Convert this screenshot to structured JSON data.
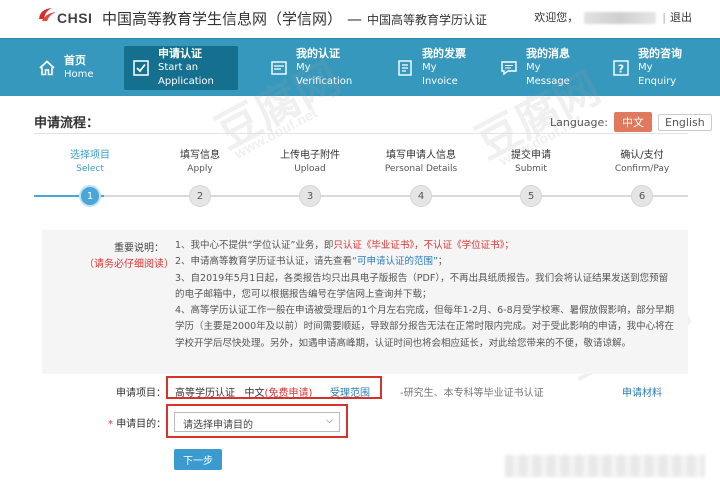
{
  "header": {
    "logo_text": "CHSI",
    "site_name": "中国高等教育学生信息网（学信网）",
    "separator": "—",
    "site_subtitle": "中国高等教育学历认证",
    "welcome": "欢迎您，",
    "logout": "退出",
    "separator_bar": "|"
  },
  "nav": {
    "items": [
      {
        "zh": "首页",
        "en": "Home",
        "icon": "home-icon"
      },
      {
        "zh": "申请认证",
        "en": "Start an Application",
        "icon": "checkbox-icon",
        "active": true
      },
      {
        "zh": "我的认证",
        "en": "My Verification",
        "icon": "certificate-icon"
      },
      {
        "zh": "我的发票",
        "en": "My Invoice",
        "icon": "invoice-icon"
      },
      {
        "zh": "我的消息",
        "en": "My Message",
        "icon": "message-icon"
      },
      {
        "zh": "我的咨询",
        "en": "My Enquiry",
        "icon": "question-icon"
      }
    ]
  },
  "process": {
    "title": "申请流程：",
    "language_label": "Language:",
    "lang_zh": "中文",
    "lang_en": "English",
    "steps": [
      {
        "zh": "选择项目",
        "en": "Select",
        "num": "1"
      },
      {
        "zh": "填写信息",
        "en": "Apply",
        "num": "2"
      },
      {
        "zh": "上传电子附件",
        "en": "Upload",
        "num": "3"
      },
      {
        "zh": "填写申请人信息",
        "en": "Personal Details",
        "num": "4"
      },
      {
        "zh": "提交申请",
        "en": "Submit",
        "num": "5"
      },
      {
        "zh": "确认/支付",
        "en": "Confirm/Pay",
        "num": "6"
      }
    ]
  },
  "notice": {
    "label": "重要说明：",
    "warning": "（请务必仔细阅读）",
    "p1_a": "1、我中心不提供“学位认证”业务，即",
    "p1_red": "只认证《毕业证书》，不认证《学位证书》；",
    "p2_a": "2、申请高等教育学历证书认证，请先查看",
    "p2_link": "“可申请认证的范围”",
    "p2_b": "；",
    "p3": "3、自2019年5月1日起，各类报告均只出具电子版报告（PDF），不再出具纸质报告。我们会将认证结果发送到您预留的电子邮箱中，您可以根据报告编号在学信网上查询并下载；",
    "p4": "4、高等学历认证工作一般在申请被受理后的1个月左右完成，但每年1-2月、6-8月受学校寒、暑假放假影响，部分早期学历（主要是2000年及以前）时间需要顺延，导致部分报告无法在正常时限内完成。对于受此影响的申请，我中心将在学校开学后尽快处理。另外，如遇申请高峰期，认证时间也将会相应延长，对此给您带来的不便，敬请谅解。"
  },
  "application": {
    "item_label": "申请项目：",
    "item_name": "高等学历认证",
    "item_lang": "中文",
    "item_free": "(免费申请)",
    "item_scope": "受理范围",
    "item_note": "-研究生、本专科等毕业证书认证",
    "item_materials": "申请材料",
    "purpose_required": "*",
    "purpose_label": "申请目的：",
    "purpose_placeholder": "请选择申请目的",
    "next_button": "下一步"
  },
  "watermark": {
    "big": "豆腐网",
    "small": "www.douf.net"
  }
}
